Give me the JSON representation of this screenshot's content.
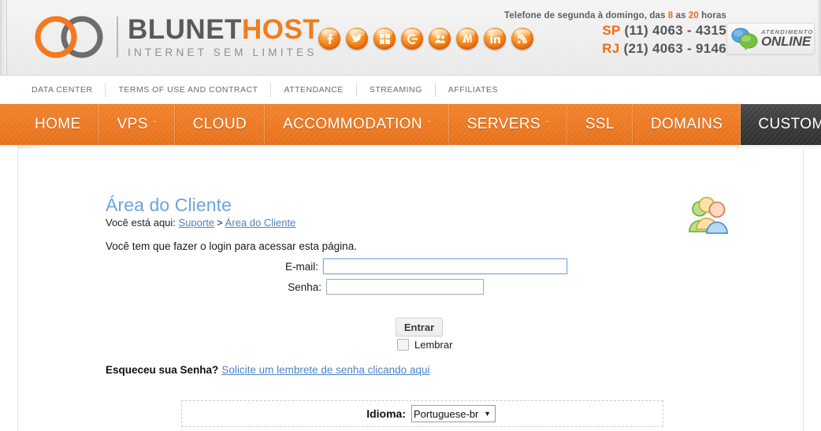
{
  "header": {
    "logo": {
      "main_first": "BLUNET",
      "main_second": "HOST",
      "tagline": "INTERNET SEM LIMITES",
      "mark": "infinity-logo-icon"
    },
    "social": [
      {
        "name": "facebook-icon",
        "glyph": "f"
      },
      {
        "name": "twitter-icon",
        "glyph": "t"
      },
      {
        "name": "windows-icon",
        "glyph": "⊞"
      },
      {
        "name": "google-icon",
        "glyph": "G"
      },
      {
        "name": "orkut-icon",
        "glyph": "o"
      },
      {
        "name": "msn-icon",
        "glyph": "m"
      },
      {
        "name": "linkedin-icon",
        "glyph": "in"
      },
      {
        "name": "rss-icon",
        "glyph": "r"
      }
    ],
    "hours_pre": "Telefone de segunda à domingo, das ",
    "hours_h1": "8",
    "hours_mid": " as ",
    "hours_h2": "20",
    "hours_post": " horas",
    "phone_sp_uf": "SP",
    "phone_sp_num": "(11)  4063 - 4315",
    "phone_rj_uf": "RJ",
    "phone_rj_num": "(21)  4063 - 9146",
    "chat_small": "ATENDIMENTO",
    "chat_big": "ONLINE",
    "chat_icon": "chat-bubbles-icon"
  },
  "subnav": {
    "items": [
      {
        "label": "DATA CENTER"
      },
      {
        "label": "TERMS OF USE AND CONTRACT"
      },
      {
        "label": "ATTENDANCE"
      },
      {
        "label": "STREAMING"
      },
      {
        "label": "AFFILIATES"
      }
    ]
  },
  "mainnav": {
    "items": [
      {
        "label": "HOME",
        "caret": false,
        "active": false
      },
      {
        "label": "VPS",
        "caret": true,
        "active": false
      },
      {
        "label": "CLOUD",
        "caret": false,
        "active": false
      },
      {
        "label": "ACCOMMODATION",
        "caret": true,
        "active": false
      },
      {
        "label": "SERVERS",
        "caret": true,
        "active": false
      },
      {
        "label": "SSL",
        "caret": false,
        "active": false
      },
      {
        "label": "DOMAINS",
        "caret": false,
        "active": false
      },
      {
        "label": "CUSTOMER CENTER",
        "caret": false,
        "active": true
      }
    ],
    "caret_glyph": "ˇ"
  },
  "main": {
    "title": "Área do Cliente",
    "breadcrumb_prefix": "Você está aqui:",
    "breadcrumb_link1": "Suporte",
    "breadcrumb_sep": ">",
    "breadcrumb_link2": "Área do Cliente",
    "login_note": "Você tem que fazer o login para acessar esta página.",
    "people_icon": "users-group-icon",
    "form": {
      "email_label": "E-mail:",
      "email_value": "",
      "password_label": "Senha:",
      "password_value": "",
      "submit_label": "Entrar",
      "remember_label": "Lembrar",
      "remember_checked": false
    },
    "forgot_bold": "Esqueceu sua Senha?",
    "forgot_link": "Solicite um lembrete de senha clicando aqui",
    "language_label": "Idioma:",
    "language_selected": "Portuguese-br",
    "language_arrow": "▼",
    "language_options": [
      "Portuguese-br"
    ]
  },
  "colors": {
    "brand_orange": "#ef7a20",
    "nav_active": "#3b3b3b",
    "link_blue": "#4d82c4",
    "title_blue": "#6ba3e0"
  }
}
